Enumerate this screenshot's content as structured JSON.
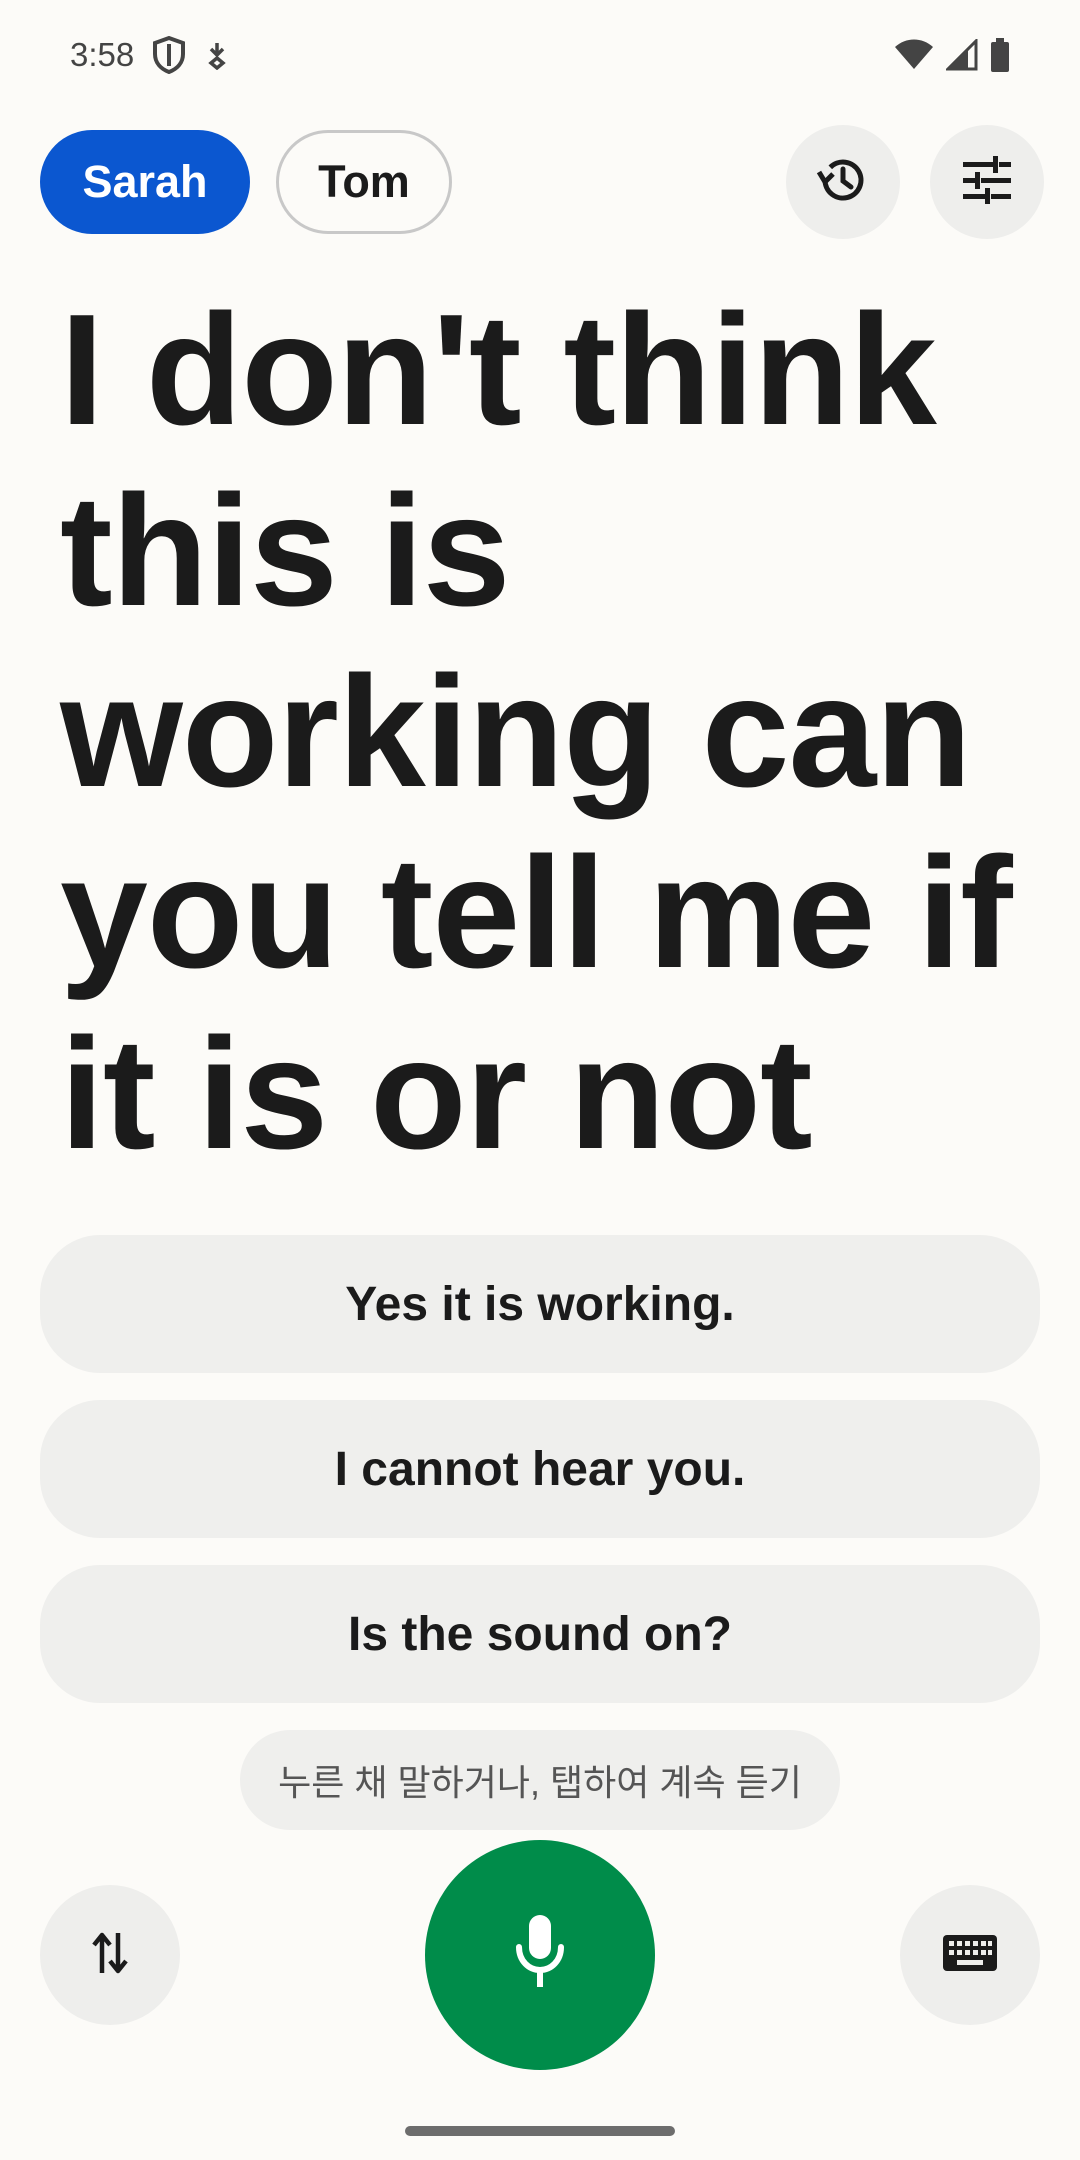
{
  "status_bar": {
    "time": "3:58"
  },
  "speakers": [
    {
      "label": "Sarah",
      "active": true
    },
    {
      "label": "Tom",
      "active": false
    }
  ],
  "transcript": {
    "text": "I don't think this is working can you tell me if it is or not"
  },
  "suggestions": [
    {
      "label": "Yes it is working."
    },
    {
      "label": "I cannot hear you."
    },
    {
      "label": "Is the sound on?"
    }
  ],
  "hint": {
    "text": "누른 채 말하거나, 탭하여 계속 듣기"
  },
  "colors": {
    "active_chip": "#0b57d0",
    "mic_button": "#008c4a",
    "background": "#fcfbf8",
    "button_surface": "#eeeeec"
  },
  "icons": {
    "history": "history-icon",
    "settings": "tune-icon",
    "swap": "swap-vert-icon",
    "mic": "mic-icon",
    "keyboard": "keyboard-icon"
  }
}
